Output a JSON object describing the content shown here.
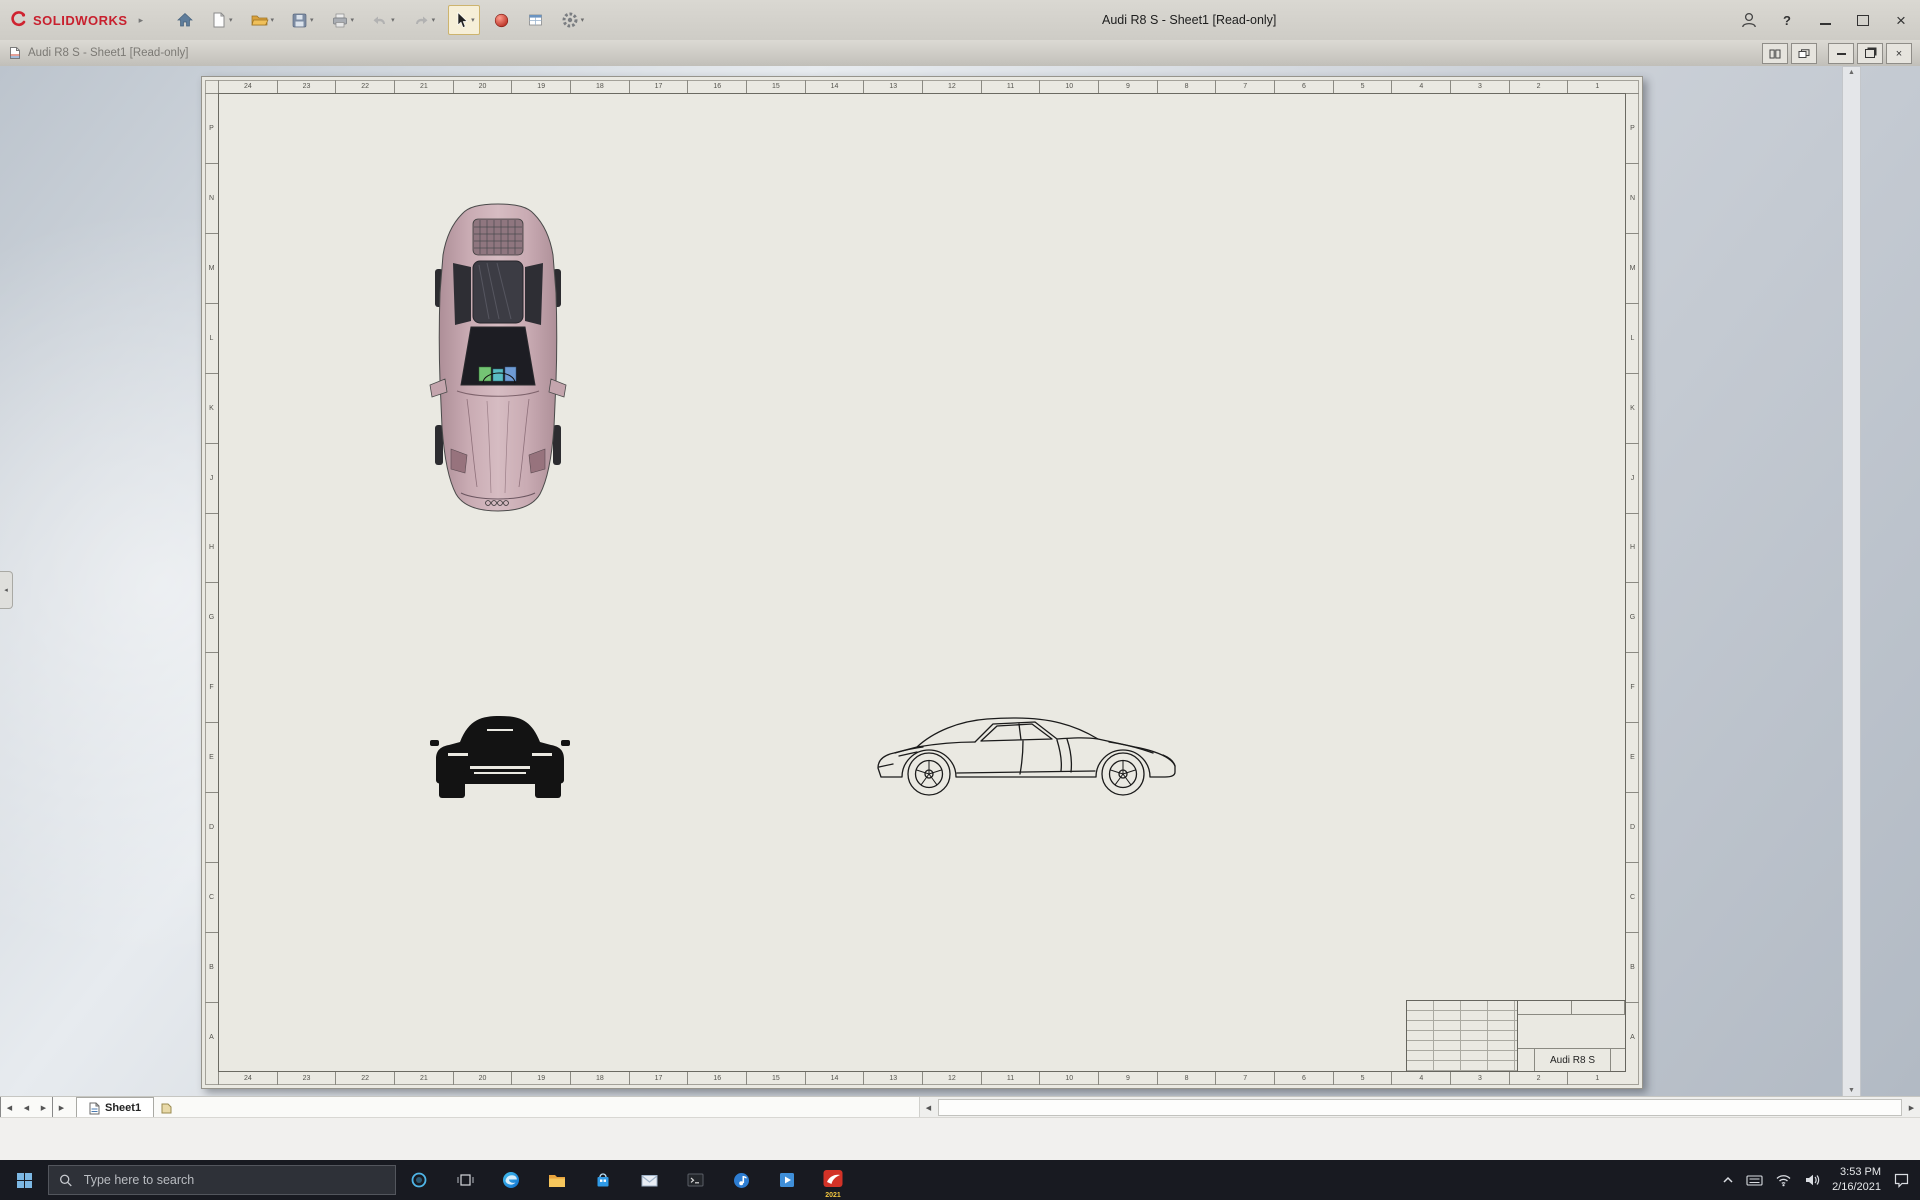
{
  "titlebar": {
    "brand": "SOLIDWORKS",
    "title": "Audi R8 S - Sheet1 [Read-only]"
  },
  "doc_window": {
    "title": "Audi R8 S - Sheet1 [Read-only]"
  },
  "sheet": {
    "h_zones": [
      "24",
      "23",
      "22",
      "21",
      "20",
      "19",
      "18",
      "17",
      "16",
      "15",
      "14",
      "13",
      "12",
      "11",
      "10",
      "9",
      "8",
      "7",
      "6",
      "5",
      "4",
      "3",
      "2",
      "1"
    ],
    "left_zones": [
      "P",
      "N",
      "M",
      "L",
      "K",
      "J",
      "H",
      "G",
      "F",
      "E",
      "D",
      "C",
      "B",
      "A"
    ],
    "title_block": {
      "model_name": "Audi R8 S"
    }
  },
  "sheet_tabs": {
    "active": "Sheet1"
  },
  "taskbar": {
    "search_placeholder": "Type here to search",
    "solidworks_year": "2021",
    "clock": {
      "time": "3:53 PM",
      "date": "2/16/2021"
    }
  },
  "colors": {
    "brand_red": "#c8202e",
    "sheet_bg": "#eae9e2",
    "taskbar_bg": "#181a21",
    "car_body_pink": "#c9abb3",
    "active_tool_highlight": "#f6efd8"
  }
}
